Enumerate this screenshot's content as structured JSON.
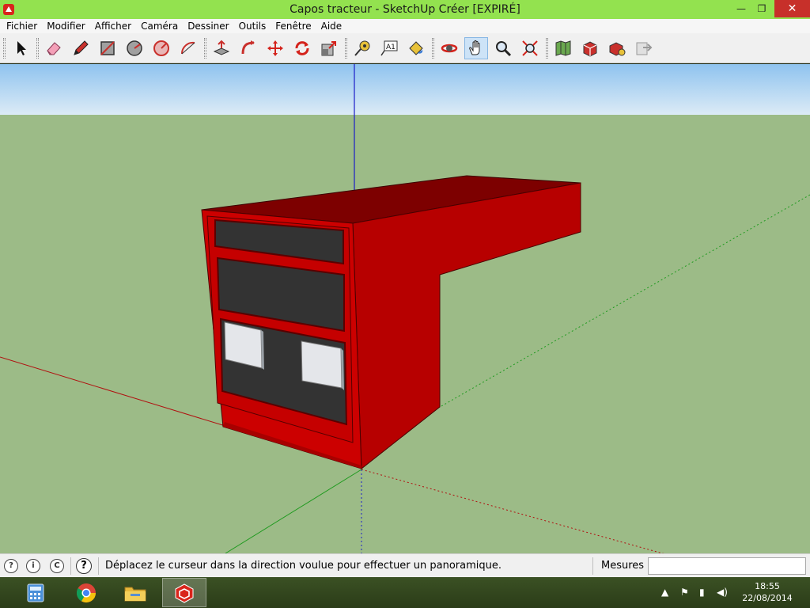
{
  "window": {
    "title": "Capos tracteur - SketchUp Créer [EXPIRÉ]",
    "minimize": "—",
    "maximize": "❐",
    "close": "✕"
  },
  "menu": [
    "Fichier",
    "Modifier",
    "Afficher",
    "Caméra",
    "Dessiner",
    "Outils",
    "Fenêtre",
    "Aide"
  ],
  "toolbar": {
    "tools": [
      {
        "name": "select-tool-icon",
        "active": false
      },
      {
        "name": "eraser-tool-icon",
        "active": false
      },
      {
        "name": "pencil-tool-icon",
        "active": false
      },
      {
        "name": "rectangle-tool-icon",
        "active": false
      },
      {
        "name": "circle-tool-icon",
        "active": false
      },
      {
        "name": "polygon-tool-icon",
        "active": false
      },
      {
        "name": "arc-tool-icon",
        "active": false
      },
      {
        "name": "push-pull-tool-icon",
        "active": false
      },
      {
        "name": "follow-me-tool-icon",
        "active": false
      },
      {
        "name": "move-tool-icon",
        "active": false
      },
      {
        "name": "rotate-tool-icon",
        "active": false
      },
      {
        "name": "scale-tool-icon",
        "active": false
      },
      {
        "name": "tape-measure-tool-icon",
        "active": false
      },
      {
        "name": "text-tool-icon",
        "active": false
      },
      {
        "name": "paint-bucket-tool-icon",
        "active": false
      },
      {
        "name": "orbit-tool-icon",
        "active": false
      },
      {
        "name": "pan-tool-icon",
        "active": true
      },
      {
        "name": "zoom-tool-icon",
        "active": false
      },
      {
        "name": "zoom-extents-tool-icon",
        "active": false
      },
      {
        "name": "add-location-icon",
        "active": false
      },
      {
        "name": "3d-warehouse-icon",
        "active": false
      },
      {
        "name": "extension-warehouse-icon",
        "active": false
      },
      {
        "name": "send-to-layout-icon",
        "active": false
      }
    ],
    "text_tool_glyph": "A1"
  },
  "colors": {
    "sky": "#a9cdef",
    "ground": "#9cbb87",
    "model_red": "#c30000",
    "model_dark_red": "#8a0000",
    "panel_dark": "#353535",
    "active_tool": "#cde3f7"
  },
  "statusbar": {
    "icons": [
      "geo-location-icon",
      "credits-icon",
      "copyright-icon"
    ],
    "icon_glyphs": [
      "?",
      "i",
      "C"
    ],
    "help": "?",
    "message": "Déplacez le curseur dans la direction voulue pour effectuer un panoramique.",
    "measurements_label": "Mesures",
    "measurements_value": ""
  },
  "taskbar": {
    "apps": [
      "calculator-icon",
      "chrome-icon",
      "file-explorer-icon",
      "sketchup-icon"
    ],
    "active_app": "sketchup-icon",
    "tray": [
      "show-hidden-icons-icon",
      "flag-icon",
      "network-icon",
      "volume-icon"
    ],
    "tray_glyphs": [
      "▲",
      "⚑",
      "▮",
      "◀)"
    ],
    "time": "18:55",
    "date": "22/08/2014"
  }
}
